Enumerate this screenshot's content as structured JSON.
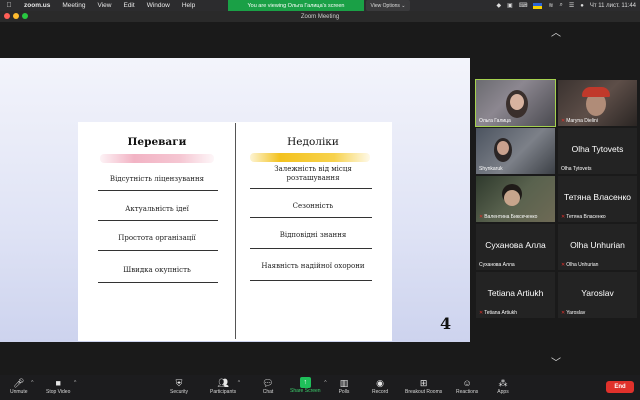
{
  "menubar": {
    "app_name": "zoom.us",
    "items": [
      "Meeting",
      "View",
      "Edit",
      "Window",
      "Help"
    ],
    "share_banner": "You are viewing Ольга Галица's screen",
    "view_options": "View Options",
    "clock": "Чт 11 лист.  11:44"
  },
  "window": {
    "title": "Zoom Meeting"
  },
  "slide": {
    "left_heading": "Переваги",
    "right_heading": "Недоліки",
    "left_items": [
      "Відсутність ліцензування",
      "Актуальність ідеї",
      "Простота організації",
      "Швидка окупність"
    ],
    "right_items": [
      "Залежність від місця розташування",
      "Сезонність",
      "Відповідні знання",
      "Наявність надійної охорони"
    ],
    "page_number": "4",
    "colors": {
      "pink_brush": "#f2b3c4",
      "gold_brush": "#f3c21e"
    }
  },
  "gallery": {
    "tiles": [
      {
        "name": "Ольга Галица",
        "muted": false,
        "video": true,
        "active": true
      },
      {
        "name": "Maryna Dielini",
        "muted": true,
        "video": true
      },
      {
        "name": "Shynkaruk",
        "muted": false,
        "video": true
      },
      {
        "name": "Olha Tytovets",
        "label": "Olha Tytovets",
        "muted": false,
        "video": false
      },
      {
        "name": "Валентина Биксеченко",
        "muted": true,
        "video": true
      },
      {
        "name": "Тетяна Власенко",
        "label": "Тетяна Власенко",
        "muted": true,
        "video": false
      },
      {
        "name": "Суханова Алла",
        "label": "Суханова Алла",
        "muted": false,
        "video": false
      },
      {
        "name": "Olha Unhurian",
        "label": "Olha Unhurian",
        "muted": true,
        "video": false
      },
      {
        "name": "Tetiana Artiukh",
        "label": "Tetiana Artiukh",
        "muted": true,
        "video": false
      },
      {
        "name": "Yaroslav",
        "label": "Yaroslav",
        "muted": true,
        "video": false
      }
    ],
    "active_color": "#a5d24f"
  },
  "toolbar": {
    "unmute": "Unmute",
    "stop_video": "Stop Video",
    "security": "Security",
    "participants": "Participants",
    "participants_count": "27",
    "chat": "Chat",
    "share_screen": "Share Screen",
    "polls": "Polls",
    "record": "Record",
    "breakout_rooms": "Breakout Rooms",
    "reactions": "Reactions",
    "apps": "Apps",
    "end": "End",
    "colors": {
      "share": "#1fbf5a",
      "end": "#e0312b"
    }
  }
}
